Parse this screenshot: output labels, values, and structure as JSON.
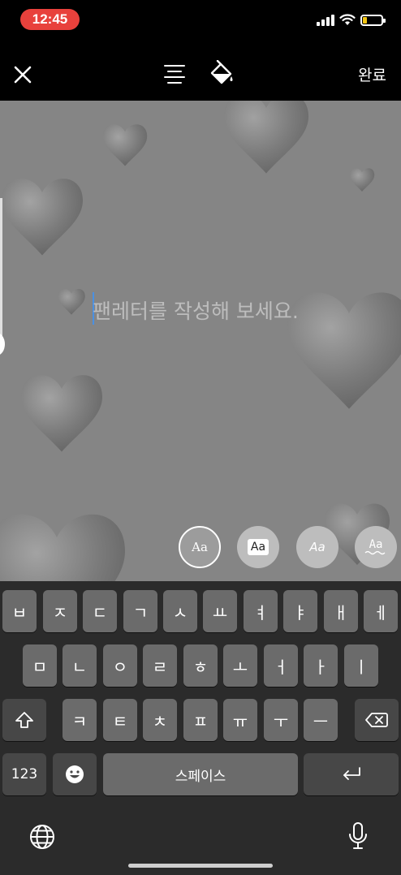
{
  "status_bar": {
    "time": "12:45",
    "time_pill_color": "#e8413c",
    "battery_level_color": "#f3c613",
    "icons": [
      "signal-icon",
      "wifi-icon",
      "battery-icon"
    ]
  },
  "toolbar": {
    "close_icon": "close-icon",
    "align_icon": "text-align-icon",
    "fill_icon": "paint-bucket-icon",
    "done_label": "완료"
  },
  "editor": {
    "placeholder": "팬레터를 작성해 보세요.",
    "background_color": "#858585",
    "cursor_color": "#4a90e2"
  },
  "font_styles": [
    {
      "label": "Aa",
      "selected": true
    },
    {
      "label": "Aa",
      "selected": false
    },
    {
      "label": "Aa",
      "selected": false
    },
    {
      "label": "Aa",
      "selected": false
    }
  ],
  "keyboard": {
    "row1": [
      "ㅂ",
      "ㅈ",
      "ㄷ",
      "ㄱ",
      "ㅅ",
      "ㅛ",
      "ㅕ",
      "ㅑ",
      "ㅐ",
      "ㅔ"
    ],
    "row2": [
      "ㅁ",
      "ㄴ",
      "ㅇ",
      "ㄹ",
      "ㅎ",
      "ㅗ",
      "ㅓ",
      "ㅏ",
      "ㅣ"
    ],
    "row3": [
      "ㅋ",
      "ㅌ",
      "ㅊ",
      "ㅍ",
      "ㅠ",
      "ㅜ",
      "ㅡ"
    ],
    "numbers_label": "123",
    "space_label": "스페이스",
    "shift_icon": "shift-icon",
    "backspace_icon": "backspace-icon",
    "emoji_icon": "emoji-icon",
    "return_icon": "return-icon",
    "globe_icon": "globe-icon",
    "mic_icon": "microphone-icon"
  }
}
